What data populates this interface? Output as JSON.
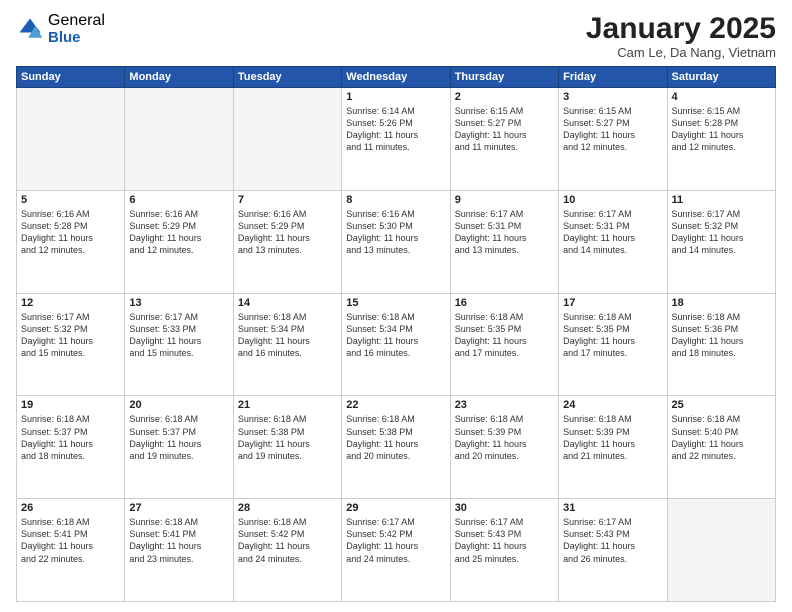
{
  "logo": {
    "general": "General",
    "blue": "Blue"
  },
  "header": {
    "month": "January 2025",
    "location": "Cam Le, Da Nang, Vietnam"
  },
  "weekdays": [
    "Sunday",
    "Monday",
    "Tuesday",
    "Wednesday",
    "Thursday",
    "Friday",
    "Saturday"
  ],
  "weeks": [
    [
      {
        "day": "",
        "info": ""
      },
      {
        "day": "",
        "info": ""
      },
      {
        "day": "",
        "info": ""
      },
      {
        "day": "1",
        "info": "Sunrise: 6:14 AM\nSunset: 5:26 PM\nDaylight: 11 hours\nand 11 minutes."
      },
      {
        "day": "2",
        "info": "Sunrise: 6:15 AM\nSunset: 5:27 PM\nDaylight: 11 hours\nand 11 minutes."
      },
      {
        "day": "3",
        "info": "Sunrise: 6:15 AM\nSunset: 5:27 PM\nDaylight: 11 hours\nand 12 minutes."
      },
      {
        "day": "4",
        "info": "Sunrise: 6:15 AM\nSunset: 5:28 PM\nDaylight: 11 hours\nand 12 minutes."
      }
    ],
    [
      {
        "day": "5",
        "info": "Sunrise: 6:16 AM\nSunset: 5:28 PM\nDaylight: 11 hours\nand 12 minutes."
      },
      {
        "day": "6",
        "info": "Sunrise: 6:16 AM\nSunset: 5:29 PM\nDaylight: 11 hours\nand 12 minutes."
      },
      {
        "day": "7",
        "info": "Sunrise: 6:16 AM\nSunset: 5:29 PM\nDaylight: 11 hours\nand 13 minutes."
      },
      {
        "day": "8",
        "info": "Sunrise: 6:16 AM\nSunset: 5:30 PM\nDaylight: 11 hours\nand 13 minutes."
      },
      {
        "day": "9",
        "info": "Sunrise: 6:17 AM\nSunset: 5:31 PM\nDaylight: 11 hours\nand 13 minutes."
      },
      {
        "day": "10",
        "info": "Sunrise: 6:17 AM\nSunset: 5:31 PM\nDaylight: 11 hours\nand 14 minutes."
      },
      {
        "day": "11",
        "info": "Sunrise: 6:17 AM\nSunset: 5:32 PM\nDaylight: 11 hours\nand 14 minutes."
      }
    ],
    [
      {
        "day": "12",
        "info": "Sunrise: 6:17 AM\nSunset: 5:32 PM\nDaylight: 11 hours\nand 15 minutes."
      },
      {
        "day": "13",
        "info": "Sunrise: 6:17 AM\nSunset: 5:33 PM\nDaylight: 11 hours\nand 15 minutes."
      },
      {
        "day": "14",
        "info": "Sunrise: 6:18 AM\nSunset: 5:34 PM\nDaylight: 11 hours\nand 16 minutes."
      },
      {
        "day": "15",
        "info": "Sunrise: 6:18 AM\nSunset: 5:34 PM\nDaylight: 11 hours\nand 16 minutes."
      },
      {
        "day": "16",
        "info": "Sunrise: 6:18 AM\nSunset: 5:35 PM\nDaylight: 11 hours\nand 17 minutes."
      },
      {
        "day": "17",
        "info": "Sunrise: 6:18 AM\nSunset: 5:35 PM\nDaylight: 11 hours\nand 17 minutes."
      },
      {
        "day": "18",
        "info": "Sunrise: 6:18 AM\nSunset: 5:36 PM\nDaylight: 11 hours\nand 18 minutes."
      }
    ],
    [
      {
        "day": "19",
        "info": "Sunrise: 6:18 AM\nSunset: 5:37 PM\nDaylight: 11 hours\nand 18 minutes."
      },
      {
        "day": "20",
        "info": "Sunrise: 6:18 AM\nSunset: 5:37 PM\nDaylight: 11 hours\nand 19 minutes."
      },
      {
        "day": "21",
        "info": "Sunrise: 6:18 AM\nSunset: 5:38 PM\nDaylight: 11 hours\nand 19 minutes."
      },
      {
        "day": "22",
        "info": "Sunrise: 6:18 AM\nSunset: 5:38 PM\nDaylight: 11 hours\nand 20 minutes."
      },
      {
        "day": "23",
        "info": "Sunrise: 6:18 AM\nSunset: 5:39 PM\nDaylight: 11 hours\nand 20 minutes."
      },
      {
        "day": "24",
        "info": "Sunrise: 6:18 AM\nSunset: 5:39 PM\nDaylight: 11 hours\nand 21 minutes."
      },
      {
        "day": "25",
        "info": "Sunrise: 6:18 AM\nSunset: 5:40 PM\nDaylight: 11 hours\nand 22 minutes."
      }
    ],
    [
      {
        "day": "26",
        "info": "Sunrise: 6:18 AM\nSunset: 5:41 PM\nDaylight: 11 hours\nand 22 minutes."
      },
      {
        "day": "27",
        "info": "Sunrise: 6:18 AM\nSunset: 5:41 PM\nDaylight: 11 hours\nand 23 minutes."
      },
      {
        "day": "28",
        "info": "Sunrise: 6:18 AM\nSunset: 5:42 PM\nDaylight: 11 hours\nand 24 minutes."
      },
      {
        "day": "29",
        "info": "Sunrise: 6:17 AM\nSunset: 5:42 PM\nDaylight: 11 hours\nand 24 minutes."
      },
      {
        "day": "30",
        "info": "Sunrise: 6:17 AM\nSunset: 5:43 PM\nDaylight: 11 hours\nand 25 minutes."
      },
      {
        "day": "31",
        "info": "Sunrise: 6:17 AM\nSunset: 5:43 PM\nDaylight: 11 hours\nand 26 minutes."
      },
      {
        "day": "",
        "info": ""
      }
    ]
  ]
}
